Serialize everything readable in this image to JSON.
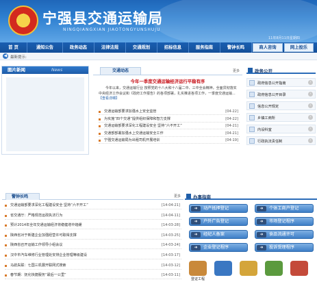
{
  "header": {
    "title": "宁强县交通运输局",
    "pinyin": "NINGQIANGXIAN   JIAOTONGYUNSHUJU",
    "date": "11年8月11日星期四"
  },
  "nav": [
    {
      "label": "首 页",
      "hl": false
    },
    {
      "label": "通知公告",
      "hl": false
    },
    {
      "label": "政务动态",
      "hl": false
    },
    {
      "label": "法律法规",
      "hl": false
    },
    {
      "label": "交通规划",
      "hl": false
    },
    {
      "label": "招标信息",
      "hl": false
    },
    {
      "label": "服务指南",
      "hl": false
    },
    {
      "label": "警钟长鸣",
      "hl": false
    },
    {
      "label": "商人咨询",
      "hl": true
    },
    {
      "label": "网上投乐",
      "hl": true
    }
  ],
  "notice_label": "最新提示:",
  "photo_news": {
    "title": "图片新闻",
    "en": "News"
  },
  "traffic": {
    "tab": "交通动态",
    "more": "更多",
    "headline": "今年一季度交通运输经济运行平稳有序",
    "summary": "今年以来，交通运输行业 按照党的十八大和十八届二中、三中全会精神，全面贯彻落实中央经济工作会议和《政府工作报告》的各项部署，扎实推进各项工作，一季度交通运输...",
    "detail": "【查看详细】",
    "news": [
      {
        "title": "交通运输部要求加强水上安全监管",
        "date": "[04-22]"
      },
      {
        "title": "为实施“四个交通”提供组织保障和智力支撑",
        "date": "[04-22]"
      },
      {
        "title": "交通运输部要求深化工程建设安全 坚持“六不开工”",
        "date": "[04-21]"
      },
      {
        "title": "交通部部署加强水上交通运输安全工作",
        "date": "[04-21]"
      },
      {
        "title": "宁强交通运输局为出租司机开展培训",
        "date": "[04-19]"
      }
    ]
  },
  "gov": {
    "title": "政务公开",
    "items": [
      "政府信息公开指南",
      "政府信息公开目录",
      "信息公开规定",
      "乡镇工商所",
      "内设科室",
      "行政执法责任制"
    ]
  },
  "notice_panel": {
    "tab": "警钟长鸣",
    "more": "更多",
    "rows": [
      {
        "title": "交通运输部要求深化工程建设安全 坚持“六不开工”",
        "date": "[14-04-21]"
      },
      {
        "title": "省交通厅：严格规范运政执法行为",
        "date": "[14-04-11]"
      },
      {
        "title": "预计2014年全年交通运输经济将稳健增中趋缓",
        "date": "[14-03-28]"
      },
      {
        "title": "陕西省对于新建企业加强经营许可取得支撑",
        "date": "[14-03-25]"
      },
      {
        "title": "陕西省召开运输工作领导小组会议",
        "date": "[14-03-24]"
      },
      {
        "title": "汉中市汽车维修行业管理处安排企业管理等级建设",
        "date": "[14-03-17]"
      },
      {
        "title": "马航失联：七国三机展开联网式搜索",
        "date": "[14-03-12]"
      },
      {
        "title": "春节期：抚化快捷服务“最后一公里”",
        "date": "[14-03-11]"
      }
    ]
  },
  "guide": {
    "title": "办事指南",
    "buttons": [
      "动产抵押登记",
      "个体工商户登记",
      "户外广告登记",
      "市场登记程序",
      "经纪人备案",
      "食品流通许可",
      "企业登记程序",
      "投诉受理程序"
    ],
    "icons": [
      "登证工程",
      "",
      "",
      "",
      ""
    ]
  }
}
